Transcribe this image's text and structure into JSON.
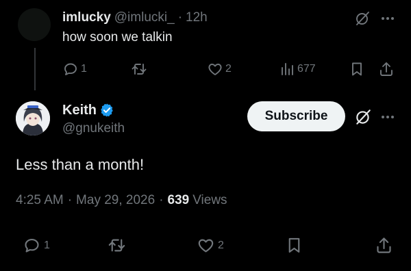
{
  "reply": {
    "display_name": "imlucky",
    "handle": "@imlucki_",
    "separator": "·",
    "time": "12h",
    "text": "how soon we talkin",
    "actions": {
      "replies": "1",
      "retweets": "",
      "likes": "2",
      "views": "677"
    }
  },
  "tweet": {
    "display_name": "Keith",
    "handle": "@gnukeith",
    "verified": true,
    "subscribe_label": "Subscribe",
    "text": "Less than a month!",
    "time": "4:25 AM",
    "separator": "·",
    "date": "May 29, 2026",
    "views_count": "639",
    "views_label": "Views",
    "actions": {
      "replies": "1",
      "retweets": "",
      "likes": "2"
    }
  },
  "colors": {
    "background": "#000000",
    "text_primary": "#e7e9ea",
    "text_secondary": "#71767b",
    "verified_blue": "#1d9bf0",
    "button_bg": "#eff3f4"
  },
  "icons": [
    "grok-icon",
    "more-icon",
    "reply-icon",
    "retweet-icon",
    "like-icon",
    "views-icon",
    "bookmark-icon",
    "share-icon",
    "verified-badge-icon"
  ]
}
